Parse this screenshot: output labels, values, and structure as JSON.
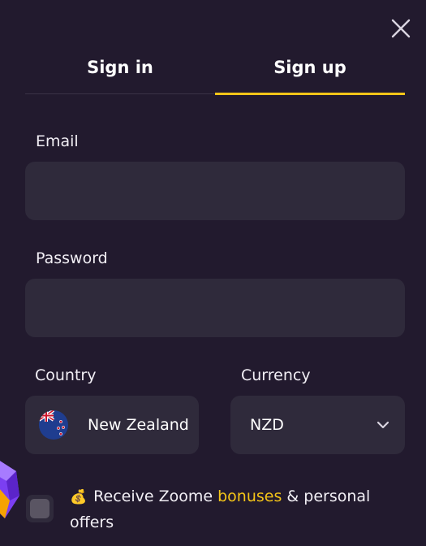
{
  "tabs": [
    {
      "label": "Sign in",
      "active": false
    },
    {
      "label": "Sign up",
      "active": true
    }
  ],
  "form": {
    "email": {
      "label": "Email",
      "value": "",
      "placeholder": ""
    },
    "password": {
      "label": "Password",
      "value": "",
      "placeholder": ""
    },
    "country": {
      "label": "Country",
      "value": "New Zealand",
      "flag_icon": "new-zealand-flag-icon"
    },
    "currency": {
      "label": "Currency",
      "value": "NZD"
    }
  },
  "offers": {
    "emoji": "💰",
    "text_before": "Receive Zoome",
    "link_text": "bonuses",
    "text_after": "& personal offers",
    "checked": false
  },
  "colors": {
    "background": "#221a2e",
    "field": "#2f2a3b",
    "accent": "#f5c518"
  }
}
